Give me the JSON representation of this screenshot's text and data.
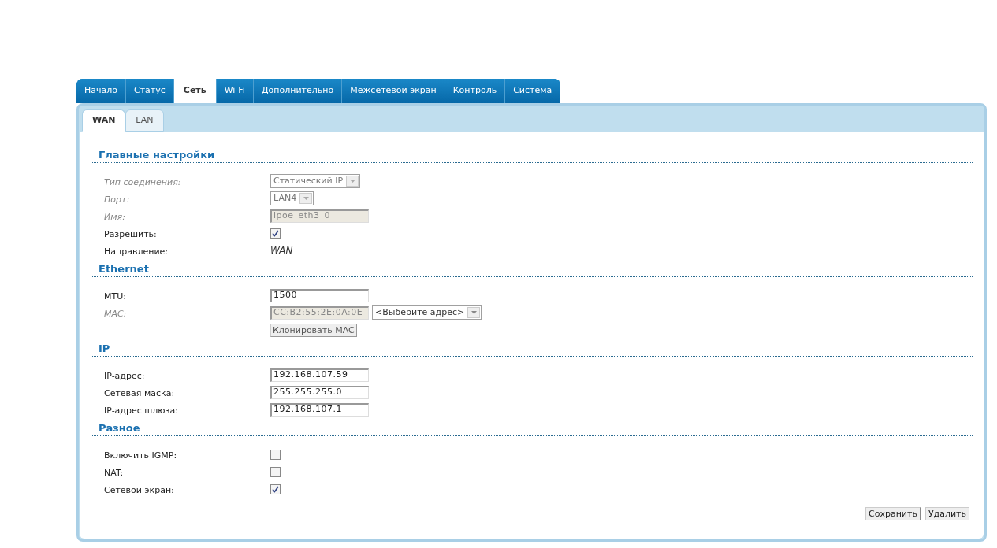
{
  "tabs": [
    {
      "label": "Начало",
      "selected": false
    },
    {
      "label": "Статус",
      "selected": false
    },
    {
      "label": "Сеть",
      "selected": true
    },
    {
      "label": "Wi-Fi",
      "selected": false
    },
    {
      "label": "Дополнительно",
      "selected": false
    },
    {
      "label": "Межсетевой экран",
      "selected": false
    },
    {
      "label": "Контроль",
      "selected": false
    },
    {
      "label": "Система",
      "selected": false
    }
  ],
  "subtabs": [
    {
      "label": "WAN",
      "selected": true
    },
    {
      "label": "LAN",
      "selected": false
    }
  ],
  "sections": [
    {
      "title": "Главные настройки",
      "rows": [
        {
          "label": "Тип соединения:",
          "disabled": true,
          "controls": [
            {
              "kind": "select",
              "value": "Статический IP",
              "disabled": true
            }
          ]
        },
        {
          "label": "Порт:",
          "disabled": true,
          "controls": [
            {
              "kind": "select",
              "value": "LAN4",
              "disabled": true
            }
          ]
        },
        {
          "label": "Имя:",
          "disabled": true,
          "controls": [
            {
              "kind": "input",
              "value": "ipoe_eth3_0",
              "disabled": true
            }
          ]
        },
        {
          "label": "Разрешить:",
          "disabled": false,
          "controls": [
            {
              "kind": "checkbox",
              "checked": true
            }
          ]
        },
        {
          "label": "Направление:",
          "disabled": false,
          "controls": [
            {
              "kind": "static",
              "value": "WAN"
            }
          ]
        }
      ]
    },
    {
      "title": "Ethernet",
      "rows": [
        {
          "label": "MTU:",
          "disabled": false,
          "controls": [
            {
              "kind": "input",
              "value": "1500",
              "disabled": false
            }
          ]
        },
        {
          "label": "MAC:",
          "disabled": true,
          "controls": [
            {
              "kind": "input",
              "value": "CC:B2:55:2E:0A:0E",
              "disabled": true
            },
            {
              "kind": "select",
              "value": "<Выберите адрес>",
              "disabled": false
            }
          ]
        },
        {
          "controls": [
            {
              "kind": "button",
              "value": "Клонировать MAC"
            }
          ]
        }
      ]
    },
    {
      "title": "IP",
      "rows": [
        {
          "label": "IP-адрес:",
          "disabled": false,
          "controls": [
            {
              "kind": "input",
              "value": "192.168.107.59",
              "disabled": false
            }
          ]
        },
        {
          "label": "Сетевая маска:",
          "disabled": false,
          "controls": [
            {
              "kind": "input",
              "value": "255.255.255.0",
              "disabled": false
            }
          ]
        },
        {
          "label": "IP-адрес шлюза:",
          "disabled": false,
          "controls": [
            {
              "kind": "input",
              "value": "192.168.107.1",
              "disabled": false
            }
          ]
        }
      ]
    },
    {
      "title": "Разное",
      "rows": [
        {
          "label": "Включить IGMP:",
          "disabled": false,
          "controls": [
            {
              "kind": "checkbox",
              "checked": false
            }
          ]
        },
        {
          "label": "NAT:",
          "disabled": false,
          "controls": [
            {
              "kind": "checkbox",
              "checked": false
            }
          ]
        },
        {
          "label": "Сетевой экран:",
          "disabled": false,
          "controls": [
            {
              "kind": "checkbox",
              "checked": true
            }
          ]
        }
      ]
    }
  ],
  "buttons": [
    "Сохранить",
    "Удалить"
  ]
}
